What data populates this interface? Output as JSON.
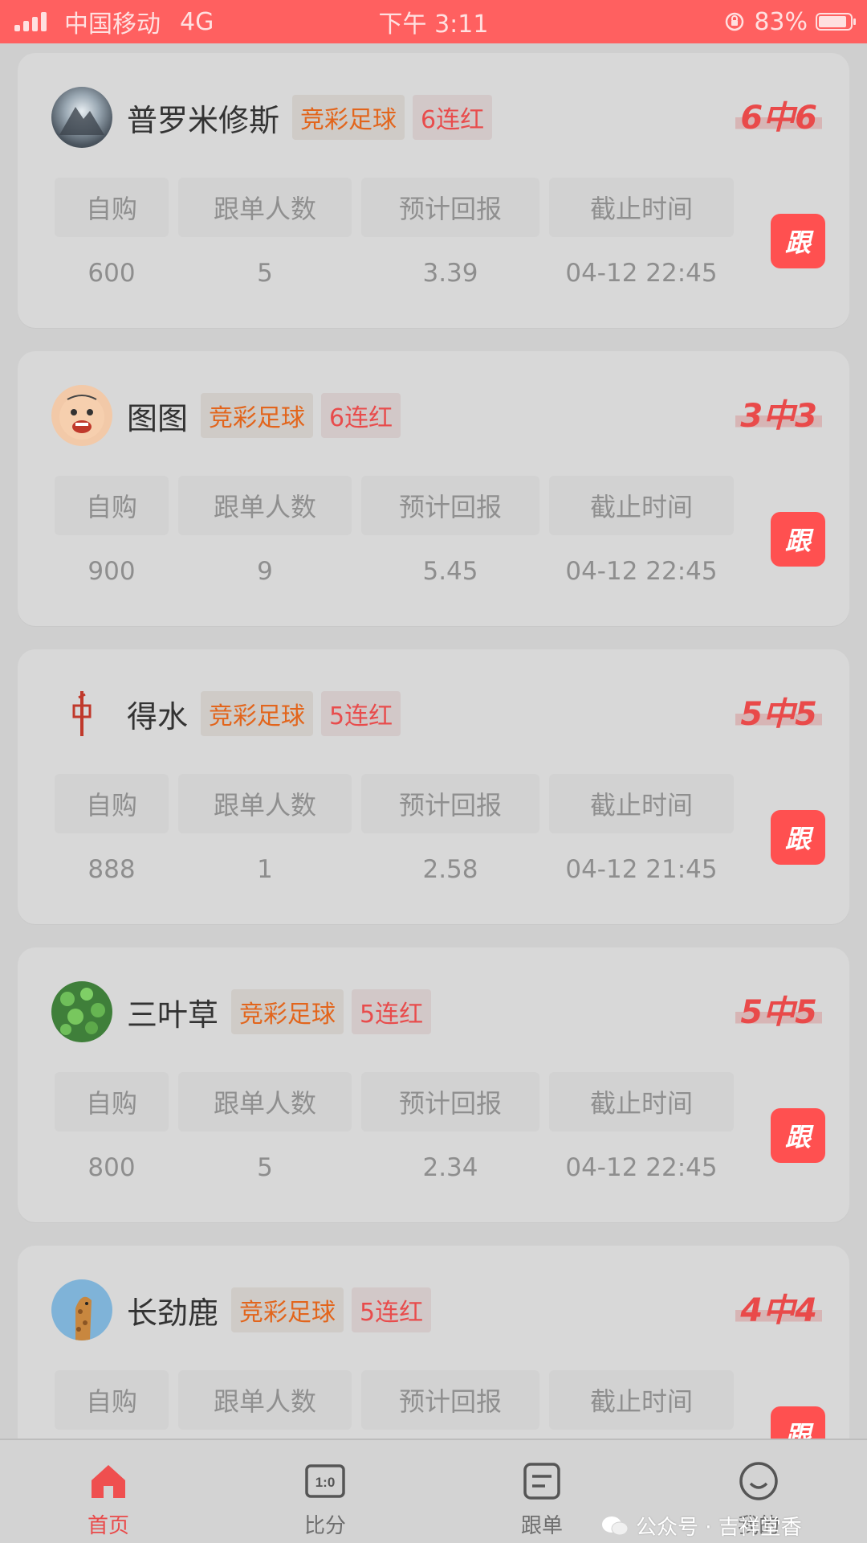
{
  "status_bar": {
    "carrier": "中国移动",
    "network": "4G",
    "time": "下午 3:11",
    "battery": "83%"
  },
  "colors": {
    "status_bar": "#ff6060",
    "accent": "#ff5050",
    "lottery_tag": "#e2651c",
    "streak_tag": "#e84c4c"
  },
  "table_headers": [
    "自购",
    "跟单人数",
    "预计回报",
    "截止时间"
  ],
  "follow_label": "跟",
  "cards": [
    {
      "name": "普罗米修斯",
      "avatar_icon": "mountain-landscape-avatar",
      "lottery": "竞彩足球",
      "streak": "6连红",
      "hit_rate": "6中6",
      "self_buy": "600",
      "followers": "5",
      "expected_return": "3.39",
      "deadline": "04-12 22:45"
    },
    {
      "name": "图图",
      "avatar_icon": "cartoon-boy-avatar",
      "lottery": "竞彩足球",
      "streak": "6连红",
      "hit_rate": "3中3",
      "self_buy": "900",
      "followers": "9",
      "expected_return": "5.45",
      "deadline": "04-12 22:45"
    },
    {
      "name": "得水",
      "avatar_icon": "red-calligraphy-avatar",
      "lottery": "竞彩足球",
      "streak": "5连红",
      "hit_rate": "5中5",
      "self_buy": "888",
      "followers": "1",
      "expected_return": "2.58",
      "deadline": "04-12 21:45"
    },
    {
      "name": "三叶草",
      "avatar_icon": "clover-leaves-avatar",
      "lottery": "竞彩足球",
      "streak": "5连红",
      "hit_rate": "5中5",
      "self_buy": "800",
      "followers": "5",
      "expected_return": "2.34",
      "deadline": "04-12 22:45"
    },
    {
      "name": "长劲鹿",
      "avatar_icon": "giraffe-avatar",
      "lottery": "竞彩足球",
      "streak": "5连红",
      "hit_rate": "4中4",
      "self_buy": "",
      "followers": "",
      "expected_return": "",
      "deadline": ""
    }
  ],
  "tabs": [
    {
      "label": "首页",
      "icon": "home-icon",
      "active": true
    },
    {
      "label": "比分",
      "icon": "scoreboard-icon",
      "icon_text": "1:0",
      "active": false
    },
    {
      "label": "跟单",
      "icon": "document-icon",
      "active": false
    },
    {
      "label": "我的",
      "icon": "smiley-icon",
      "active": false
    }
  ],
  "watermark": "公众号 · 吉祥堂香"
}
